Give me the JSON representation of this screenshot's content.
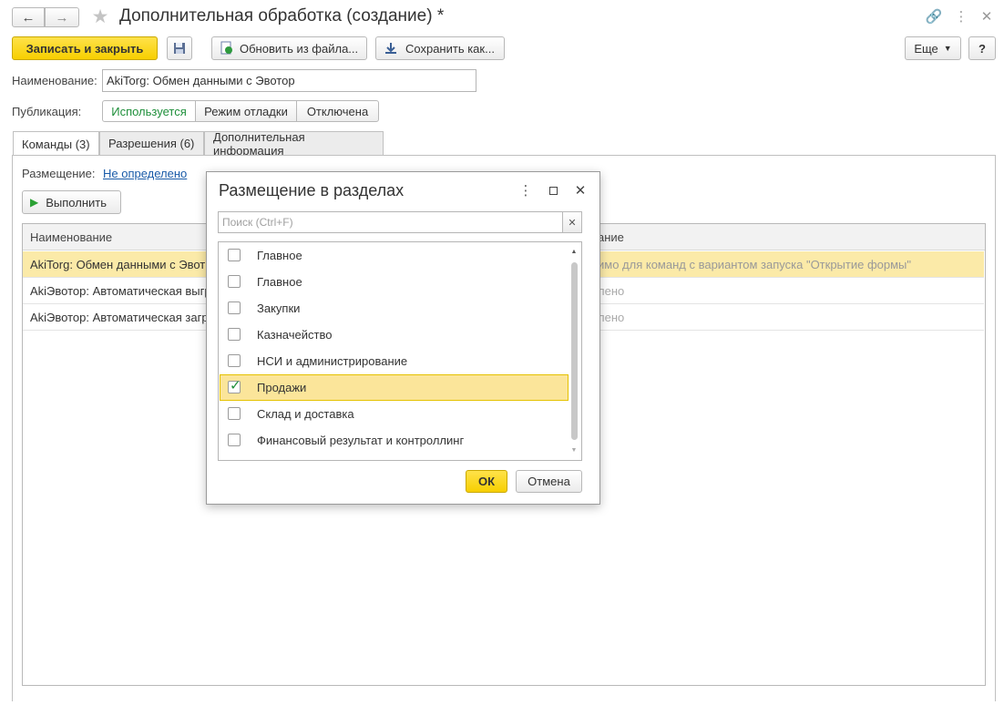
{
  "window": {
    "title": "Дополнительная обработка (создание) *"
  },
  "toolbar": {
    "save_close": "Записать и закрыть",
    "update_from_file": "Обновить из файла...",
    "save_as": "Сохранить как...",
    "more": "Еще",
    "help": "?"
  },
  "form": {
    "name_label": "Наименование:",
    "name_value": "AkiTorg: Обмен данными с Эвотор",
    "publication_label": "Публикация:",
    "publication_options": [
      "Используется",
      "Режим отладки",
      "Отключена"
    ],
    "publication_selected": "Используется"
  },
  "tabs": [
    {
      "label": "Команды (3)",
      "active": true
    },
    {
      "label": "Разрешения (6)",
      "active": false
    },
    {
      "label": "Дополнительная информация",
      "active": false
    }
  ],
  "commands": {
    "placement_label": "Размещение:",
    "placement_value": "Не определено",
    "run_label": "Выполнить",
    "columns": [
      "Наименование",
      "ание"
    ],
    "rows": [
      {
        "name": "AkiTorg: Обмен данными с Эвот",
        "extra": "имо для команд с вариантом запуска \"Открытие формы\"",
        "selected": true
      },
      {
        "name": "AkiЭвотор: Автоматическая выгр",
        "extra": "лено",
        "selected": false
      },
      {
        "name": "AkiЭвотор: Автоматическая загр",
        "extra": "лено",
        "selected": false
      }
    ]
  },
  "dialog": {
    "title": "Размещение в разделах",
    "search_placeholder": "Поиск (Ctrl+F)",
    "items": [
      {
        "label": "Главное",
        "checked": false
      },
      {
        "label": "Главное",
        "checked": false
      },
      {
        "label": "Закупки",
        "checked": false
      },
      {
        "label": "Казначейство",
        "checked": false
      },
      {
        "label": "НСИ и администрирование",
        "checked": false
      },
      {
        "label": "Продажи",
        "checked": true
      },
      {
        "label": "Склад и доставка",
        "checked": false
      },
      {
        "label": "Финансовый результат и контроллинг",
        "checked": false
      }
    ],
    "ok": "ОК",
    "cancel": "Отмена"
  },
  "colors": {
    "accent_yellow": "#f7cf00",
    "selected_row": "#fbeaa8",
    "link_blue": "#1a5ba8",
    "active_green": "#1e8f3a"
  }
}
